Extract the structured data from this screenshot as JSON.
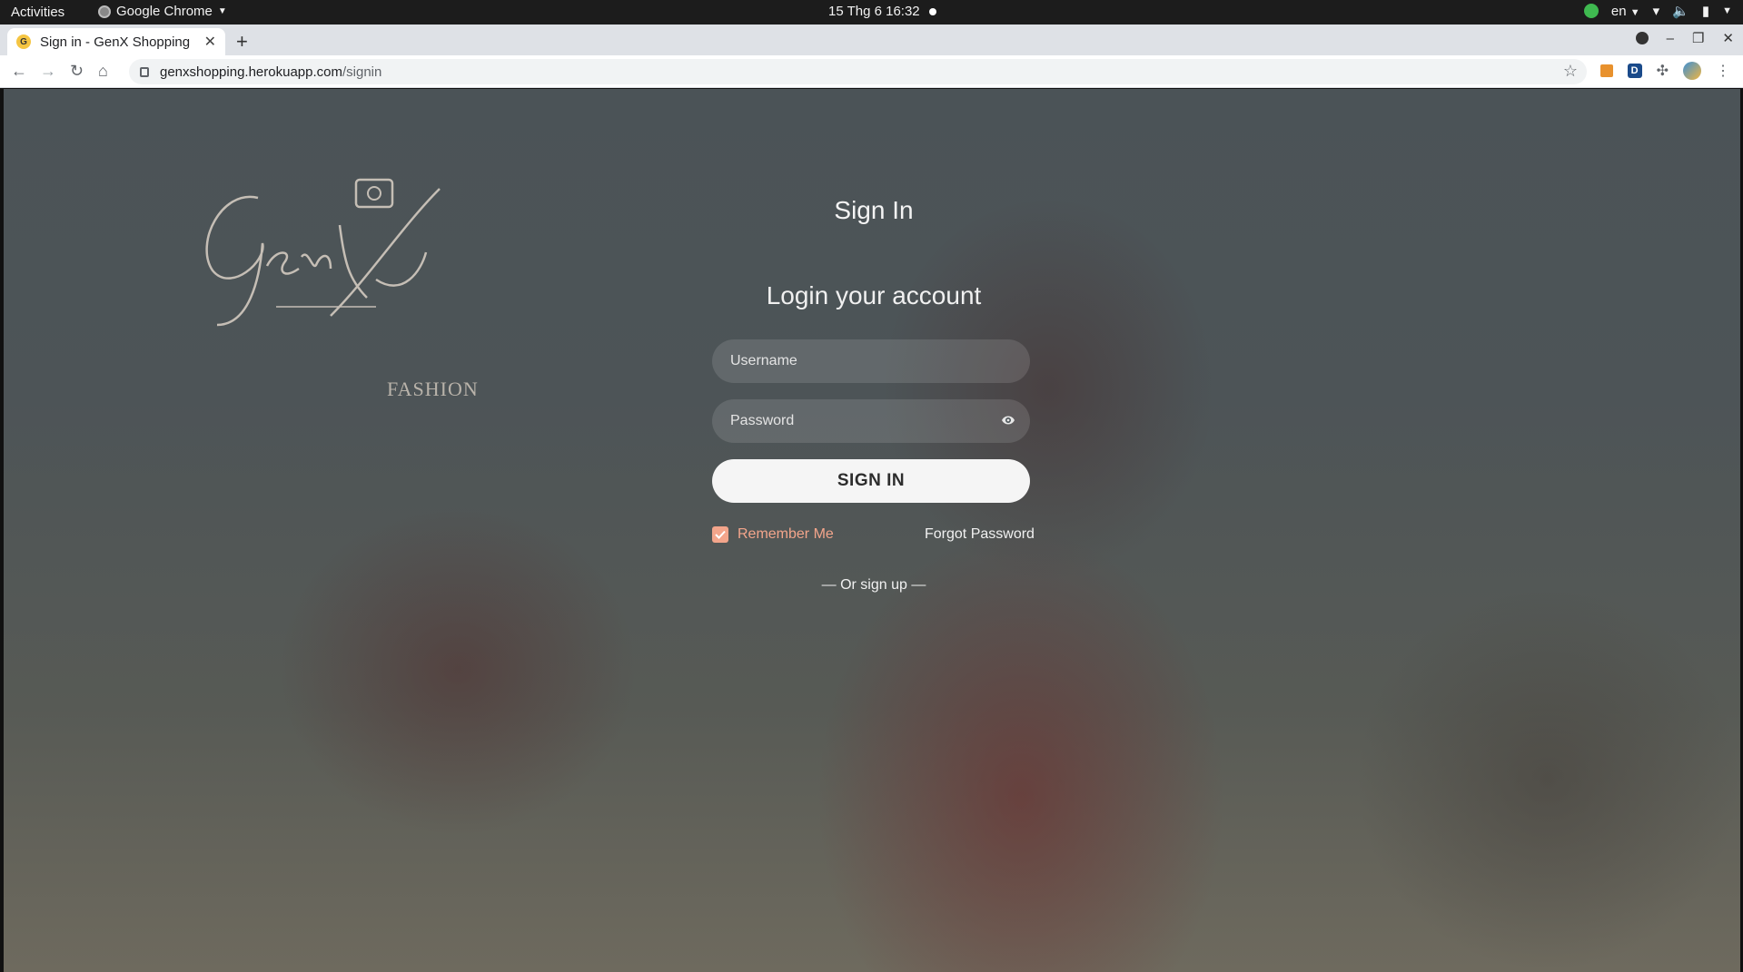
{
  "os_bar": {
    "activities": "Activities",
    "app_name": "Google Chrome",
    "clock": "15 Thg 6  16:32",
    "lang": "en"
  },
  "browser": {
    "tab_title": "Sign in - GenX Shopping",
    "favicon_letter": "G",
    "url_domain": "genxshopping.herokuapp.com",
    "url_path": "/signin",
    "ext_letter": "D"
  },
  "page": {
    "logo_word": "FASHION",
    "heading": "Sign In",
    "subheading": "Login your account",
    "username_placeholder": "Username",
    "password_placeholder": "Password",
    "signin_button": "SIGN IN",
    "remember_label": "Remember Me",
    "remember_checked": true,
    "forgot_link": "Forgot Password",
    "signup_text": "— Or sign up —"
  },
  "colors": {
    "accent": "#f3a58b",
    "overlay": "#4b5357"
  }
}
